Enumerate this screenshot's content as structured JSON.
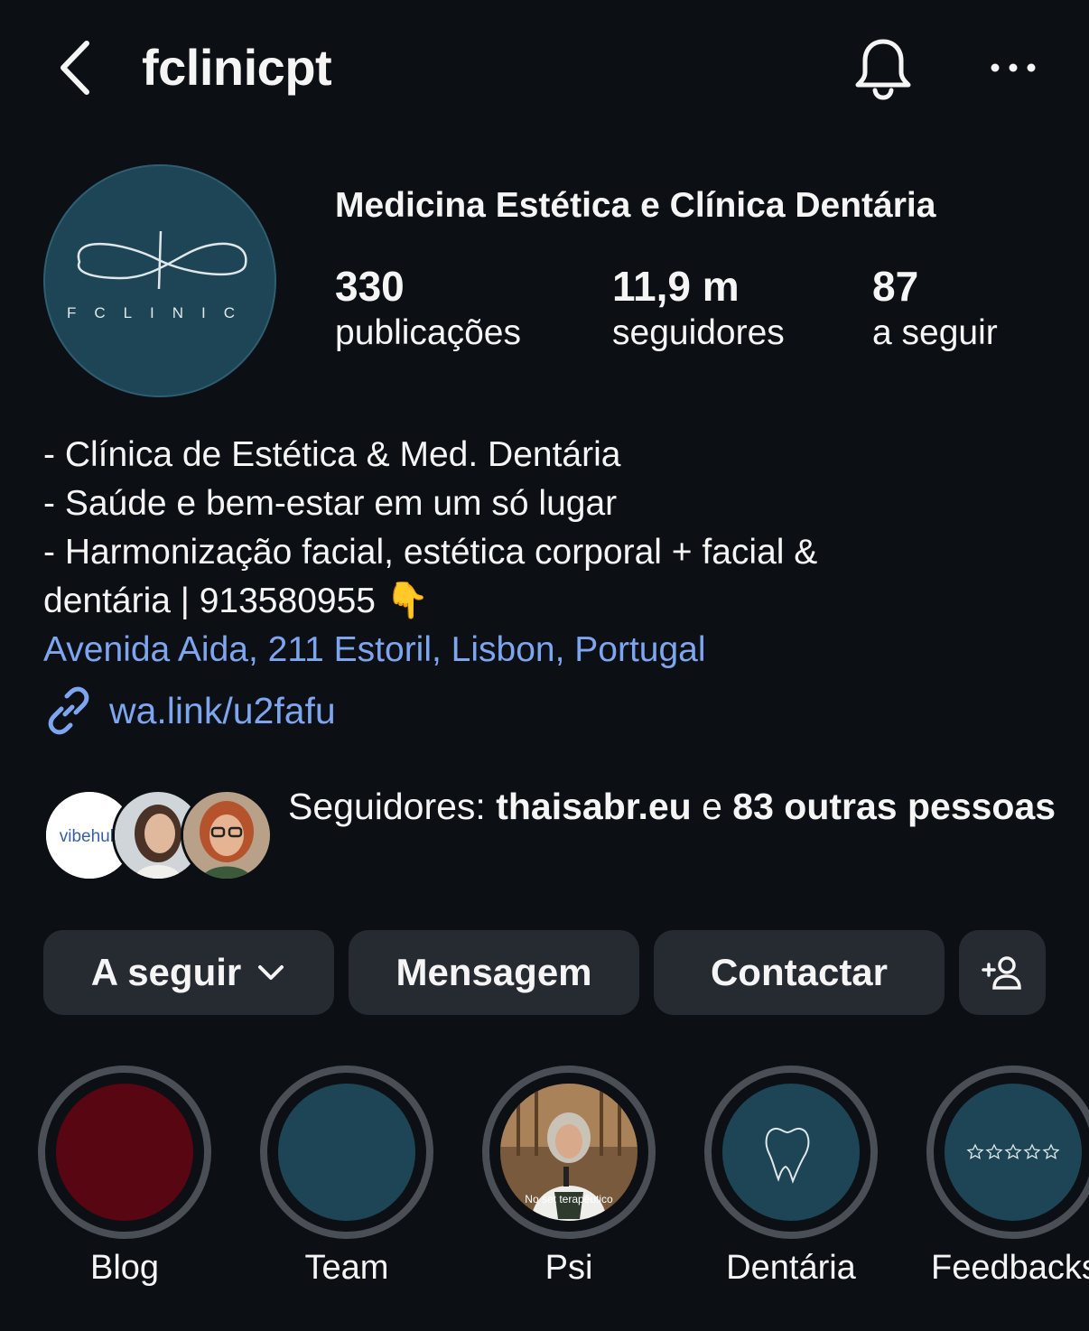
{
  "header": {
    "username": "fclinicpt",
    "back_icon": "chevron-left-icon",
    "notification_icon": "bell-icon",
    "more_icon": "more-horizontal-icon"
  },
  "profile": {
    "avatar_text": "FCLINIC",
    "avatar_color": "#1d4555",
    "full_name": "Medicina Estética e Clínica Dentária",
    "stats": [
      {
        "count": "330",
        "label": "publicações"
      },
      {
        "count": "11,9 m",
        "label": "seguidores"
      },
      {
        "count": "87",
        "label": "a seguir"
      }
    ],
    "bio": [
      "- Clínica de Estética & Med. Dentária",
      "- Saúde e bem-estar em um só lugar",
      "- Harmonização facial, estética corporal + facial &",
      "dentária | 913580955 👇"
    ],
    "address": "Avenida Aida, 211 Estoril, Lisbon, Portugal",
    "link": "wa.link/u2fafu",
    "link_icon": "link-icon"
  },
  "followed_by": {
    "prefix": "Seguidores: ",
    "user": "thaisabr.eu",
    "joiner": " e ",
    "others": "83 outras pessoas",
    "first_avatar_text": "vibehub"
  },
  "actions": {
    "follow_label": "A seguir",
    "message_label": "Mensagem",
    "contact_label": "Contactar",
    "add_user_icon": "add-person-icon"
  },
  "highlights": [
    {
      "label": "Blog",
      "color": "#570612"
    },
    {
      "label": "Team",
      "color": "#1d4555"
    },
    {
      "label": "Psi",
      "caption": "No set terapêutico"
    },
    {
      "label": "Dentária",
      "color": "#1d4555"
    },
    {
      "label": "Feedbacks",
      "color": "#1d4555"
    }
  ],
  "colors": {
    "background": "#0c1014",
    "link": "#7ea6f0",
    "button_bg": "#262a31"
  }
}
